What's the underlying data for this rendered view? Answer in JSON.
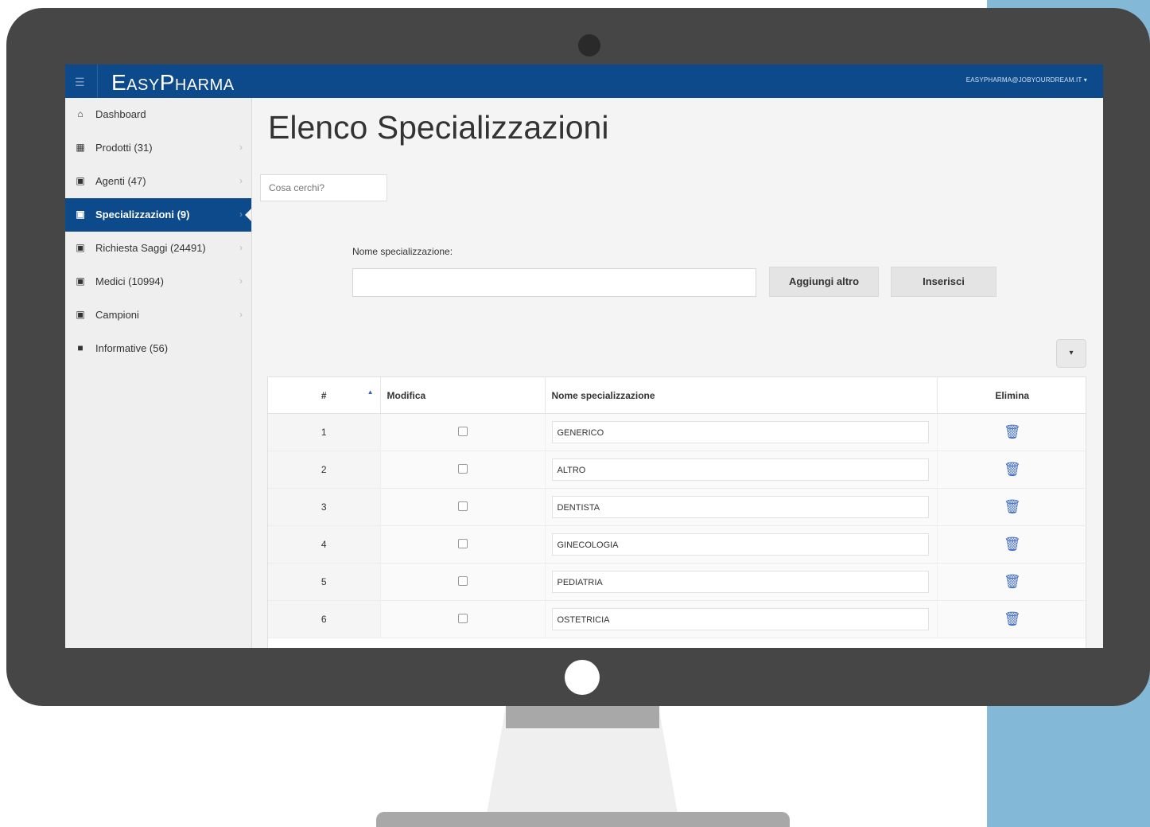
{
  "app": {
    "logo": "EasyPharma",
    "user_email": "EASYPHARMA@JOBYOURDREAM.IT ▾"
  },
  "sidebar": {
    "items": [
      {
        "label": "Dashboard",
        "icon": "home-icon",
        "has_chevron": false
      },
      {
        "label": "Prodotti (31)",
        "icon": "grid-icon",
        "has_chevron": true
      },
      {
        "label": "Agenti (47)",
        "icon": "briefcase-icon",
        "has_chevron": true
      },
      {
        "label": "Specializzazioni (9)",
        "icon": "briefcase-icon",
        "has_chevron": true,
        "active": true
      },
      {
        "label": "Richiesta Saggi (24491)",
        "icon": "briefcase-icon",
        "has_chevron": true
      },
      {
        "label": "Medici (10994)",
        "icon": "briefcase-icon",
        "has_chevron": true
      },
      {
        "label": "Campioni",
        "icon": "briefcase-icon",
        "has_chevron": true
      },
      {
        "label": "Informative (56)",
        "icon": "document-icon",
        "has_chevron": false
      }
    ]
  },
  "main": {
    "title": "Elenco Specializzazioni",
    "search_placeholder": "Cosa cerchi?",
    "field_label": "Nome specializzazione:",
    "add_button": "Aggiungi altro",
    "insert_button": "Inserisci",
    "dropdown_icon": "▾"
  },
  "table": {
    "headers": {
      "num": "#",
      "edit": "Modifica",
      "name": "Nome specializzazione",
      "delete": "Elimina"
    },
    "rows": [
      {
        "id": "1",
        "name": "GENERICO"
      },
      {
        "id": "2",
        "name": "ALTRO"
      },
      {
        "id": "3",
        "name": "DENTISTA"
      },
      {
        "id": "4",
        "name": "GINECOLOGIA"
      },
      {
        "id": "5",
        "name": "PEDIATRIA"
      },
      {
        "id": "6",
        "name": "OSTETRICIA"
      }
    ]
  },
  "colors": {
    "topbar": "#0c4a8c",
    "accent": "#3f6cc0",
    "bezel": "#464646",
    "side_accent": "#83b8d6"
  }
}
